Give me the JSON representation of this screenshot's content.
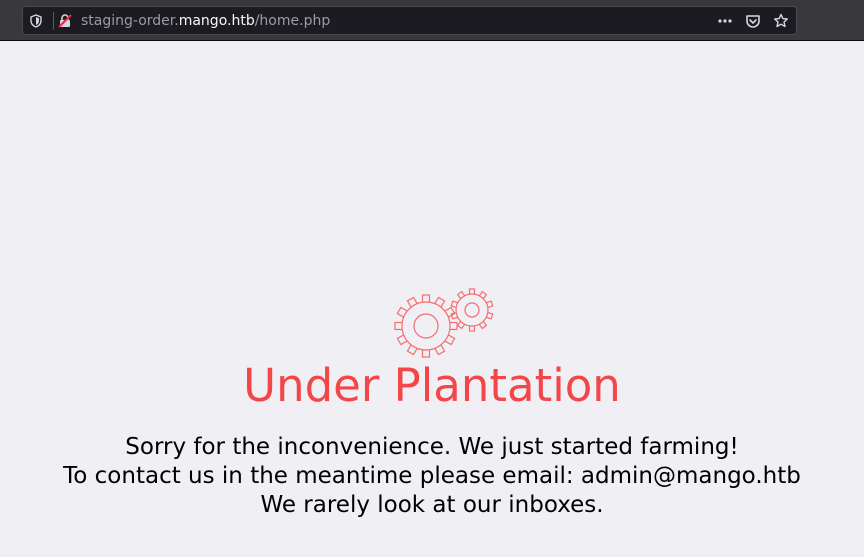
{
  "browser": {
    "url_prefix": "staging-order.",
    "url_host": "mango.htb",
    "url_path": "/home.php",
    "icons": {
      "tracking": "shield-icon",
      "connection": "insecure-lock-icon",
      "page_actions": "more-actions-icon",
      "pocket": "pocket-icon",
      "bookmark": "star-icon"
    }
  },
  "page": {
    "graphic": "gears-icon",
    "title": "Under Plantation",
    "lines": [
      "Sorry for the inconvenience. We just started farming!",
      "To contact us in the meantime please email: admin@mango.htb",
      "We rarely look at our inboxes."
    ],
    "accent_color": "#f34649"
  }
}
